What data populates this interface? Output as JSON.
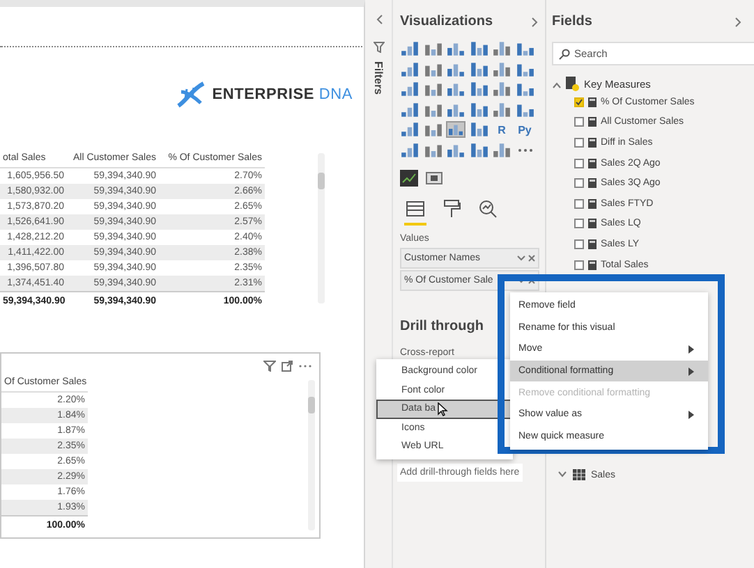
{
  "logo": {
    "word1": "ENTERPRISE",
    "word2": "DNA"
  },
  "table_top": {
    "columns": [
      "otal Sales",
      "All Customer Sales",
      "% Of Customer Sales"
    ],
    "rows": [
      [
        "1,605,956.50",
        "59,394,340.90",
        "2.70%"
      ],
      [
        "1,580,932.00",
        "59,394,340.90",
        "2.66%"
      ],
      [
        "1,573,870.20",
        "59,394,340.90",
        "2.65%"
      ],
      [
        "1,526,641.90",
        "59,394,340.90",
        "2.57%"
      ],
      [
        "1,428,212.20",
        "59,394,340.90",
        "2.40%"
      ],
      [
        "1,411,422.00",
        "59,394,340.90",
        "2.38%"
      ],
      [
        "1,396,507.80",
        "59,394,340.90",
        "2.35%"
      ],
      [
        "1,374,451.40",
        "59,394,340.90",
        "2.31%"
      ]
    ],
    "total": [
      "59,394,340.90",
      "59,394,340.90",
      "100.00%"
    ]
  },
  "table_bottom": {
    "columns": [
      "Of Customer Sales"
    ],
    "rows": [
      [
        "2.20%"
      ],
      [
        "1.84%"
      ],
      [
        "1.87%"
      ],
      [
        "2.35%"
      ],
      [
        "2.65%"
      ],
      [
        "2.29%"
      ],
      [
        "1.76%"
      ],
      [
        "1.93%"
      ]
    ],
    "total": [
      "100.00%"
    ]
  },
  "filters": {
    "title": "Filters"
  },
  "visualizations": {
    "title": "Visualizations",
    "gallery": [
      {
        "kind": "glyph",
        "selected": false
      },
      {
        "kind": "glyph",
        "selected": false
      },
      {
        "kind": "glyph",
        "selected": false
      },
      {
        "kind": "glyph",
        "selected": false
      },
      {
        "kind": "glyph",
        "selected": false
      },
      {
        "kind": "glyph",
        "selected": false
      },
      {
        "kind": "glyph",
        "selected": false
      },
      {
        "kind": "glyph",
        "selected": false
      },
      {
        "kind": "glyph",
        "selected": false
      },
      {
        "kind": "glyph",
        "selected": false
      },
      {
        "kind": "glyph",
        "selected": false
      },
      {
        "kind": "glyph",
        "selected": false
      },
      {
        "kind": "glyph",
        "selected": false
      },
      {
        "kind": "glyph",
        "selected": false
      },
      {
        "kind": "glyph",
        "selected": false
      },
      {
        "kind": "glyph",
        "selected": false
      },
      {
        "kind": "glyph",
        "selected": false
      },
      {
        "kind": "glyph",
        "selected": false
      },
      {
        "kind": "glyph",
        "selected": false
      },
      {
        "kind": "glyph",
        "selected": false
      },
      {
        "kind": "glyph",
        "selected": false
      },
      {
        "kind": "glyph",
        "selected": false
      },
      {
        "kind": "glyph",
        "selected": false
      },
      {
        "kind": "glyph",
        "selected": false
      },
      {
        "kind": "glyph",
        "selected": false
      },
      {
        "kind": "glyph",
        "selected": false
      },
      {
        "kind": "glyph",
        "selected": true
      },
      {
        "kind": "glyph",
        "selected": false
      },
      {
        "kind": "letter",
        "label": "R",
        "selected": false
      },
      {
        "kind": "letter",
        "label": "Py",
        "selected": false
      },
      {
        "kind": "glyph",
        "selected": false
      },
      {
        "kind": "glyph",
        "selected": false
      },
      {
        "kind": "glyph",
        "selected": false
      },
      {
        "kind": "glyph",
        "selected": false
      },
      {
        "kind": "glyph",
        "selected": false
      },
      {
        "kind": "more",
        "selected": false
      }
    ],
    "pane_tabs": [
      {
        "kind": "fields",
        "selected": true
      },
      {
        "kind": "format",
        "selected": false
      },
      {
        "kind": "analytics",
        "selected": false
      }
    ],
    "values_label": "Values",
    "wells": [
      "Customer Names",
      "% Of Customer Sale"
    ],
    "drill_title": "Drill through",
    "cross_report": "Cross-report",
    "drill_placeholder": "Add drill-through fields here"
  },
  "format_submenu": [
    {
      "label": "Background color",
      "selected": false
    },
    {
      "label": "Font color",
      "selected": false
    },
    {
      "label": "Data ba",
      "selected": true
    },
    {
      "label": "Icons",
      "selected": false
    },
    {
      "label": "Web URL",
      "selected": false
    }
  ],
  "fields": {
    "title": "Fields",
    "search": {
      "placeholder": "Search"
    },
    "group": {
      "name": "Key Measures",
      "expanded": true,
      "items": [
        {
          "label": "% Of Customer Sales",
          "checked": true
        },
        {
          "label": "All Customer Sales",
          "checked": false
        },
        {
          "label": "Diff in Sales",
          "checked": false
        },
        {
          "label": "Sales 2Q Ago",
          "checked": false
        },
        {
          "label": "Sales 3Q Ago",
          "checked": false
        },
        {
          "label": "Sales FTYD",
          "checked": false
        },
        {
          "label": "Sales LQ",
          "checked": false
        },
        {
          "label": "Sales LY",
          "checked": false
        },
        {
          "label": "Total Sales",
          "checked": false
        }
      ]
    },
    "tables": [
      {
        "name": "Sales",
        "expanded": false
      }
    ]
  },
  "context_menu": [
    {
      "label": "Remove field",
      "kind": "item",
      "disabled": false,
      "selected": false
    },
    {
      "label": "Rename for this visual",
      "kind": "item",
      "disabled": false,
      "selected": false
    },
    {
      "label": "Move",
      "kind": "submenu",
      "disabled": false,
      "selected": false
    },
    {
      "label": "Conditional formatting",
      "kind": "submenu",
      "disabled": false,
      "selected": true
    },
    {
      "label": "Remove conditional formatting",
      "kind": "item",
      "disabled": true,
      "selected": false
    },
    {
      "label": "Show value as",
      "kind": "submenu",
      "disabled": false,
      "selected": false
    },
    {
      "label": "New quick measure",
      "kind": "item",
      "disabled": false,
      "selected": false
    }
  ]
}
